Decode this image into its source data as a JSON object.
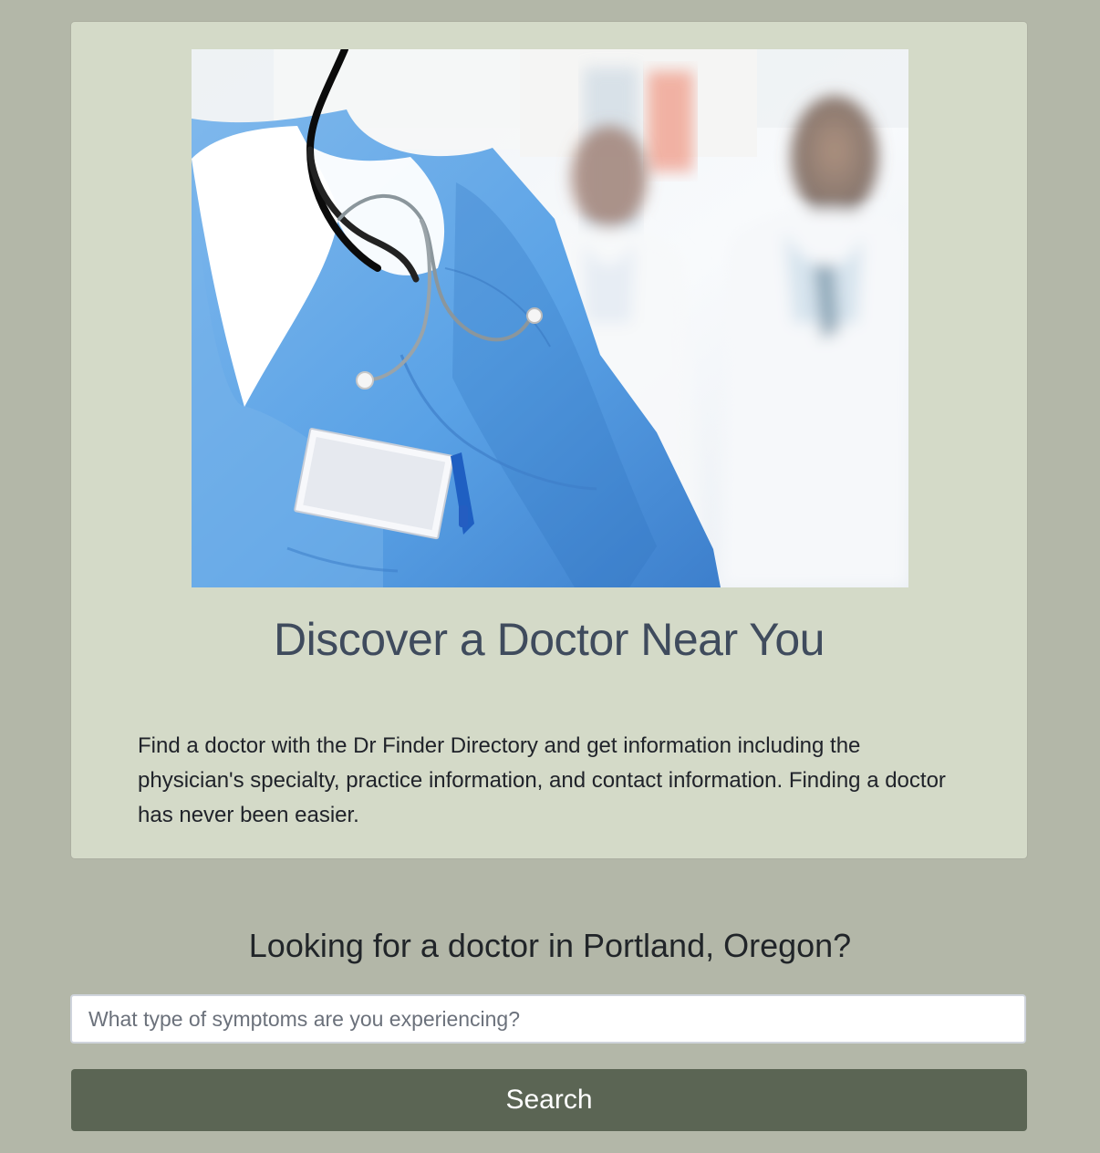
{
  "hero": {
    "title": "Discover a Doctor Near You",
    "description": "Find a doctor with the Dr Finder Directory and get information including the physician's specialty, practice information, and contact information. Finding a doctor has never been easier."
  },
  "search": {
    "heading": "Looking for a doctor in Portland, Oregon?",
    "placeholder": "What type of symptoms are you experiencing?",
    "value": "",
    "button_label": "Search"
  },
  "colors": {
    "page_background": "#b3b7a8",
    "card_background": "#d4dac8",
    "title_color": "#3f4b5d",
    "button_background": "#5b6554"
  }
}
